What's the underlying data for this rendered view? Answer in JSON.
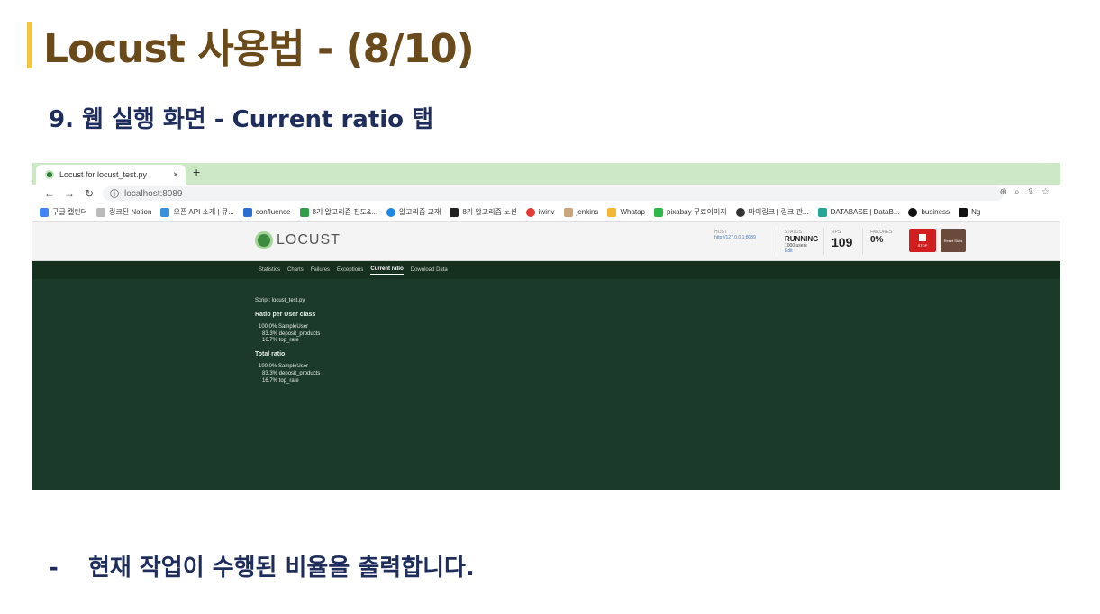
{
  "slide": {
    "title": "Locust 사용법 - (8/10)",
    "subtitle": "9. 웹 실행 화면 - Current ratio 탭",
    "note_dash": "-",
    "note": "현재 작업이 수행된 비율을 출력합니다."
  },
  "browser": {
    "tab_title": "Locust for locust_test.py",
    "tab_close": "×",
    "new_tab": "+",
    "url": "localhost:8089",
    "bookmarks": [
      "구글 캘린더",
      "링크된 Notion",
      "오픈 API 소개 | 큐...",
      "confluence",
      "8기 알고리즘 진도&...",
      "알고리즘 교재",
      "8기 알고리즘 노션",
      "iwinv",
      "jenkins",
      "Whatap",
      "pixabay 무료이미지",
      "마이링크 | 링크 관...",
      "DATABASE | DataB...",
      "business",
      "Ng"
    ]
  },
  "locust": {
    "logo": "LOCUST",
    "host_label": "HOST",
    "host_value": "http://127.0.0.1:8089",
    "status_label": "STATUS",
    "status_value": "RUNNING",
    "users_value": "1000 users",
    "edit_label": "Edit",
    "rps_label": "RPS",
    "rps_value": "109",
    "failures_label": "FAILURES",
    "failures_value": "0%",
    "stop_label": "STOP",
    "reset_label": "Reset Stats",
    "tabs": [
      "Statistics",
      "Charts",
      "Failures",
      "Exceptions",
      "Current ratio",
      "Download Data"
    ],
    "script_line": "Script: locust_test.py",
    "ratio_per_class_title": "Ratio per User class",
    "ratio_per_class": [
      "100.0% SampleUser",
      "83.3% deposit_products",
      "16.7% top_rate"
    ],
    "total_ratio_title": "Total ratio",
    "total_ratio": [
      "100.0% SampleUser",
      "83.3% deposit_products",
      "16.7% top_rate"
    ]
  },
  "colors": {
    "title": "#6a4a1a",
    "accent_bar": "#f0c542",
    "subtitle": "#1f2d5c",
    "locust_bg": "#1c3a2a",
    "stop": "#d11f1f"
  }
}
